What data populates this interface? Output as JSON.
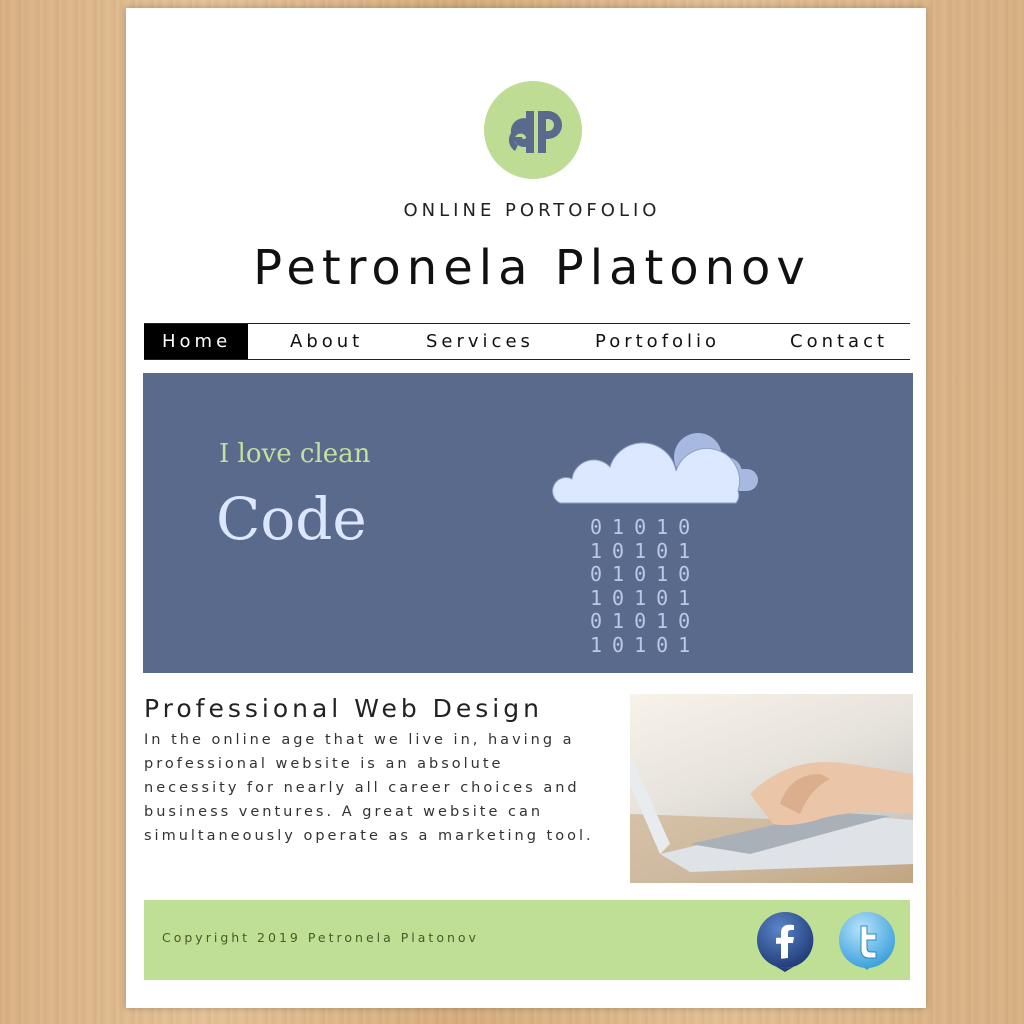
{
  "header": {
    "logo_text": "JP",
    "subtitle": "ONLINE PORTOFOLIO",
    "name": "Petronela Platonov"
  },
  "nav": {
    "items": [
      {
        "label": "Home",
        "active": true
      },
      {
        "label": "About",
        "active": false
      },
      {
        "label": "Services",
        "active": false
      },
      {
        "label": "Portofolio",
        "active": false
      },
      {
        "label": "Contact",
        "active": false
      }
    ]
  },
  "hero": {
    "line1": "I love clean",
    "line2": "Code",
    "binary_rows": [
      "01010",
      "10101",
      "01010",
      "10101",
      "01010",
      "10101"
    ],
    "cloud_icon": "cloud-icon"
  },
  "content": {
    "title": "Professional Web Design",
    "body": "In the online age that we live in, having a professional website is an absolute necessity for nearly all career choices and business ventures. A great website can simultaneously operate as a marketing tool.",
    "photo": "laptop-typing-photo"
  },
  "footer": {
    "copyright": "Copyright 2019 Petronela Platonov",
    "social": [
      {
        "icon": "facebook-icon",
        "letter": "f"
      },
      {
        "icon": "twitter-icon",
        "letter": "t"
      }
    ]
  },
  "colors": {
    "logo_green": "#bfdc94",
    "logo_blue": "#5a6a8c",
    "hero_bg": "#5a6a8c",
    "hero_green": "#c5e09d",
    "footer_bg": "#bfdf95"
  }
}
